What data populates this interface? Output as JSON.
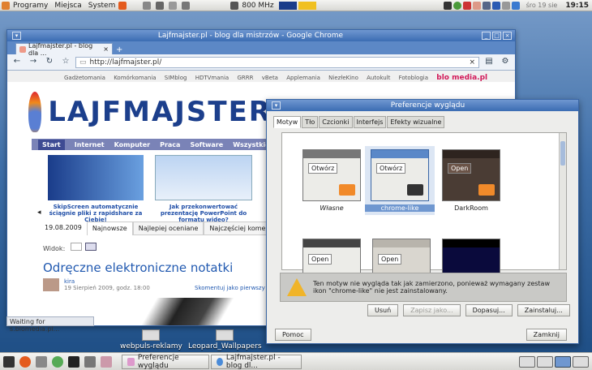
{
  "top_panel": {
    "menus": [
      "Programy",
      "Miejsca",
      "System"
    ],
    "cpu": "800 MHz",
    "date": "śro 19 sie",
    "clock": "19:15"
  },
  "desktop": {
    "icons": [
      {
        "label": "webpuls-reklamy"
      },
      {
        "label": "Leopard_Wallpapers"
      }
    ]
  },
  "chrome": {
    "window_title": "Lajfmajster.pl - blog dla mistrzów - Google Chrome",
    "tab_title": "Lajfmajster.pl - blog dla ...",
    "url": "http://lajfmajster.pl/",
    "status": "Waiting for s.blomedia.pl...",
    "page": {
      "top_links": [
        "Gadżetomania",
        "Komórkomania",
        "SIMblog",
        "HDTVmania",
        "GRRR",
        "vBeta",
        "Applemania",
        "NiezłeKino",
        "Autokult",
        "Fotoblogia"
      ],
      "brand": "blo media.pl",
      "logo": "LAJFMAJSTER",
      "nav": [
        "Start",
        "Internet",
        "Komputer",
        "Praca",
        "Software",
        "Wszystkie"
      ],
      "promo_left": "SkipScreen automatycznie ściągnie pliki z rapidshare za Ciebie!",
      "promo_right": "Jak przekonwertować prezentację PowerPoint do formatu wideo?",
      "date": "19.08.2009",
      "tabs": [
        "Najnowsze",
        "Najlepiej oceniane",
        "Najczęściej komentowane"
      ],
      "view_label": "Widok:",
      "headline": "Odręczne elektroniczne notatki",
      "author": "kira",
      "post_date": "19 Sierpień 2009, godz. 18:00",
      "comment_link": "Skomentuj jako pierwszy"
    }
  },
  "prefs": {
    "title": "Preferencje wyglądu",
    "tabs": [
      "Motyw",
      "Tło",
      "Czcionki",
      "Interfejs",
      "Efekty wizualne"
    ],
    "themes": [
      {
        "name": "Własne",
        "button": "Otwórz"
      },
      {
        "name": "chrome-like",
        "button": "Otwórz"
      },
      {
        "name": "DarkRoom",
        "button": "Open"
      },
      {
        "name": "",
        "button": "Open"
      },
      {
        "name": "",
        "button": "Open"
      },
      {
        "name": "",
        "button": ""
      }
    ],
    "warning": "Ten motyw nie wygląda tak jak zamierzono, ponieważ wymagany zestaw ikon \"chrome-like\" nie jest zainstalowany.",
    "buttons": {
      "remove": "Usuń",
      "save": "Zapisz jako...",
      "customize": "Dopasuj...",
      "install": "Zainstaluj...",
      "help": "Pomoc",
      "close": "Zamknij"
    }
  },
  "taskbar": {
    "items": [
      "Preferencje wyglądu",
      "Lajfmajster.pl - blog dl..."
    ]
  }
}
